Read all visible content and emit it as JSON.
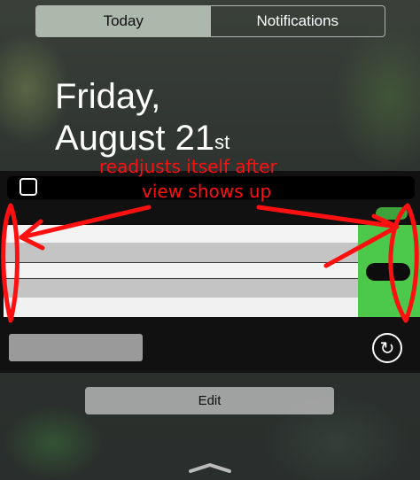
{
  "tabs": [
    {
      "label": "Today",
      "active": true
    },
    {
      "label": "Notifications",
      "active": false
    }
  ],
  "date": {
    "line1": "Friday,",
    "line2_main": "August 21",
    "line2_sup": "st"
  },
  "annotation": {
    "line1": "readjusts itself after",
    "line2": "view shows up",
    "color": "#ff1010"
  },
  "icons": {
    "refresh": "refresh-icon",
    "handle": "grabber-chevron-icon",
    "widget": "widget-square-icon"
  },
  "edit_label": "Edit",
  "colors": {
    "accent_green": "#4cc84a",
    "annotation_red": "#ff1010"
  }
}
